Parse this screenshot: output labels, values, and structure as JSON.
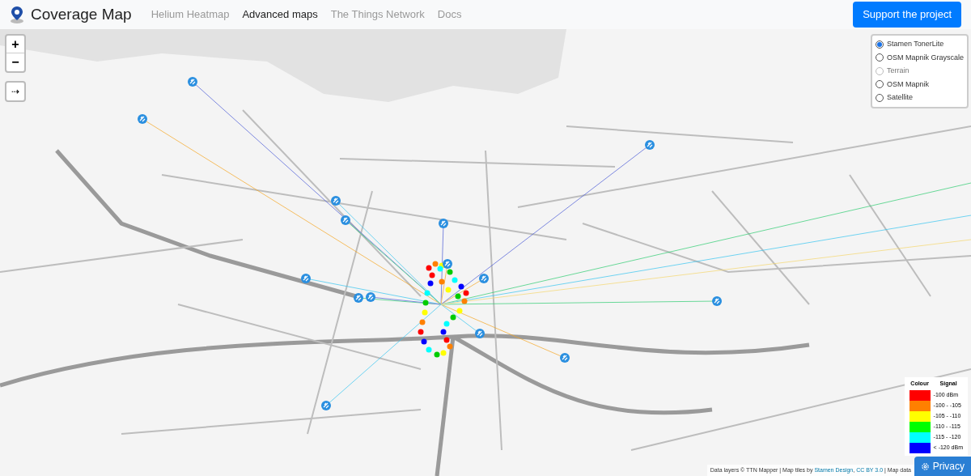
{
  "navbar": {
    "brand": "Coverage Map",
    "links": [
      {
        "label": "Helium Heatmap",
        "selected": false
      },
      {
        "label": "Advanced maps",
        "selected": true
      },
      {
        "label": "The Things Network",
        "selected": false
      },
      {
        "label": "Docs",
        "selected": false
      }
    ],
    "button": "Support the project"
  },
  "map_controls": {
    "zoom_in": "+",
    "zoom_out": "−",
    "locate": "⇢"
  },
  "layers": [
    {
      "label": "Stamen TonerLite",
      "selected": true,
      "disabled": false
    },
    {
      "label": "OSM Mapnik Grayscale",
      "selected": false,
      "disabled": false
    },
    {
      "label": "Terrain",
      "selected": false,
      "disabled": true
    },
    {
      "label": "OSM Mapnik",
      "selected": false,
      "disabled": false
    },
    {
      "label": "Satellite",
      "selected": false,
      "disabled": false
    }
  ],
  "legend": {
    "colour_heading": "Colour",
    "signal_heading": "Signal",
    "items": [
      {
        "label": "-100 dBm",
        "color": "#ff0000"
      },
      {
        "label": "-100 - -105",
        "color": "#ff8000"
      },
      {
        "label": "-105 - -110",
        "color": "#ffff00"
      },
      {
        "label": "-110 - -115",
        "color": "#00ff00"
      },
      {
        "label": "-115 - -120",
        "color": "#00ffff"
      },
      {
        "label": "< -120 dBm",
        "color": "#0000ff"
      }
    ]
  },
  "attribution": {
    "prefix": "Data layers © TTN Mapper | Map tiles by ",
    "link1": "Stamen Design",
    "sep": ", ",
    "link2": "CC BY 3.0",
    "suffix": " | Map data"
  },
  "privacy_button": "Privacy"
}
